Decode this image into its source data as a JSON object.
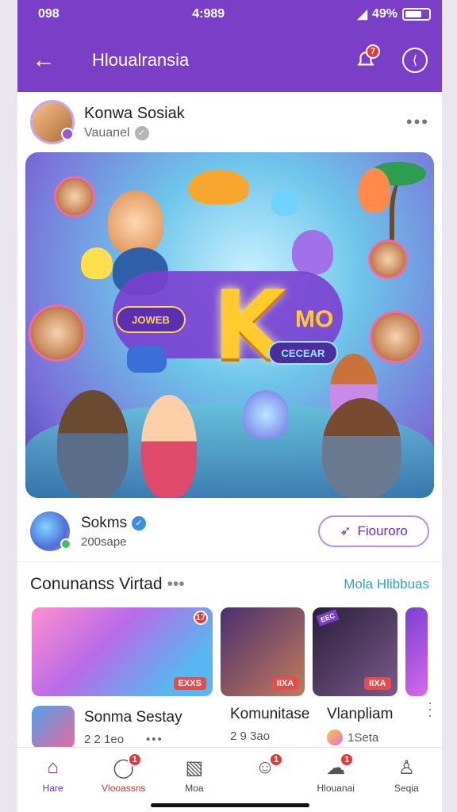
{
  "status": {
    "time_left": "098",
    "time_center": "4:989",
    "battery": "49%"
  },
  "appbar": {
    "title": "Hloualransia",
    "bell_badge": "7"
  },
  "post": {
    "author": "Konwa Sosiak",
    "subtitle": "Vauanel",
    "more": "•••"
  },
  "hero": {
    "pill_left": "JOWEB",
    "pill_right": "CECEAR",
    "big_letter": "K",
    "mo_text": "MO"
  },
  "creator": {
    "name": "Sokms",
    "followers": "200sape",
    "follow_label": "Fiouroro"
  },
  "section": {
    "title": "Conunanss Virtad",
    "dots": "•••",
    "link": "Mola Hlibbuas"
  },
  "rail": {
    "tags": [
      "EXXS",
      "IIXA",
      "IIXA"
    ],
    "badge_1": "17",
    "stamp_3": "EEC",
    "items": [
      {
        "title": "Sonma Sestay",
        "meta": "2 2 1eo",
        "dots": "•••"
      },
      {
        "title": "Komunitase",
        "meta": "2 9 3ao"
      },
      {
        "title": "Vlanpliam",
        "meta": "1Seta"
      }
    ]
  },
  "nav": [
    {
      "label": "Hare",
      "badge": ""
    },
    {
      "label": "Vlooassns",
      "badge": "1"
    },
    {
      "label": "Moa",
      "badge": ""
    },
    {
      "label": "",
      "badge": "1"
    },
    {
      "label": "Hlouanai",
      "badge": "1"
    },
    {
      "label": "Seqia",
      "badge": ""
    }
  ]
}
